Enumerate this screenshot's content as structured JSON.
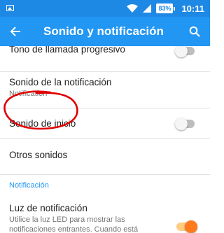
{
  "status_bar": {
    "time": "10:11",
    "battery": "83%",
    "icons": [
      "image-icon",
      "wifi-icon",
      "cell-signal-icon",
      "battery-icon"
    ]
  },
  "app_bar": {
    "title": "Sonido y notificación",
    "back_icon": "arrow-back-icon",
    "search_icon": "search-icon",
    "color": "#2196f3"
  },
  "settings": {
    "progressive_ringtone": {
      "title": "Tono de llamada progresivo",
      "switch_on": false
    },
    "notification_sound": {
      "title": "Sonido de la notificación",
      "summary": "Notification"
    },
    "startup_sound": {
      "title": "Sonido de inicio",
      "switch_on": false
    },
    "other_sounds": {
      "title": "Otros sonidos"
    },
    "notification_header": "Notificación",
    "notification_light": {
      "title": "Luz de notificación",
      "summary": "Utilice la luz LED para mostrar las notificaciones entrantes. Cuando está",
      "switch_on": true
    }
  },
  "annotation": {
    "color": "#e00000"
  },
  "colors": {
    "accent": "#ff7a1a",
    "statusbar": "#1e88e5"
  }
}
